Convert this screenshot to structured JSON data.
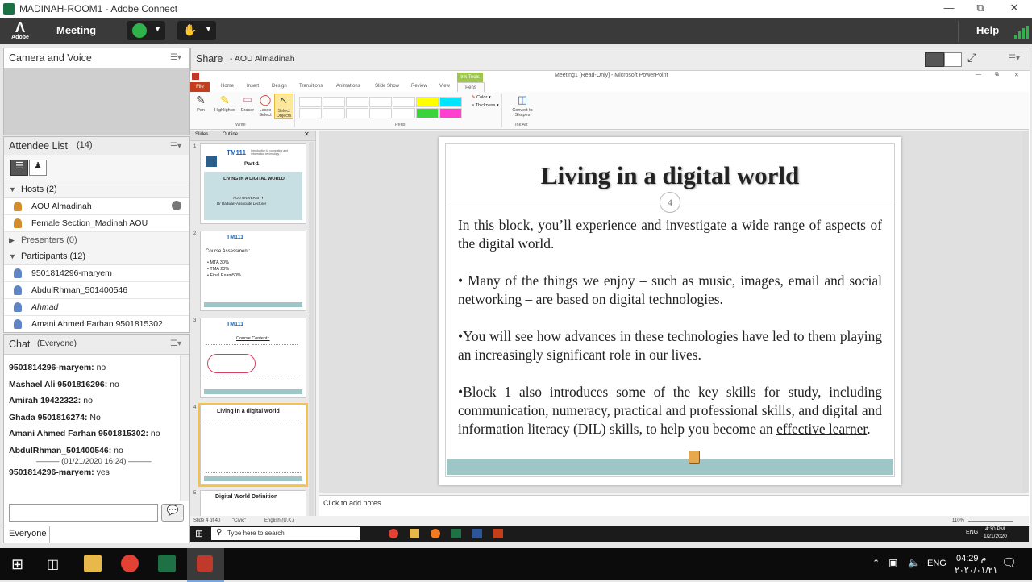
{
  "window": {
    "title": "MADINAH-ROOM1 - Adobe Connect"
  },
  "menubar": {
    "logo": "Adobe",
    "meeting_label": "Meeting",
    "help_label": "Help"
  },
  "camera_pane": {
    "title": "Camera and Voice"
  },
  "attendee_pane": {
    "title": "Attendee List",
    "count": "(14)",
    "groups": [
      {
        "label": "Hosts (2)",
        "members": [
          "AOU  Almadinah",
          "Female Section_Madinah AOU"
        ]
      },
      {
        "label": "Presenters (0)",
        "members": []
      },
      {
        "label": "Participants (12)",
        "members": [
          "9501814296-maryem",
          "AbdulRhman_501400546",
          "Ahmad",
          "Amani Ahmed Farhan 9501815302"
        ]
      }
    ]
  },
  "chat_pane": {
    "title": "Chat",
    "scope": "(Everyone)",
    "messages": [
      {
        "sender": "9501814296-maryem:",
        "text": "no"
      },
      {
        "sender": "Mashael Ali 9501816296:",
        "text": "no"
      },
      {
        "sender": "Amirah 19422322:",
        "text": "no"
      },
      {
        "sender": "Ghada 9501816274:",
        "text": "No"
      },
      {
        "sender": "Amani Ahmed Farhan 9501815302:",
        "text": "no"
      },
      {
        "sender": "AbdulRhman_501400546:",
        "text": "no"
      }
    ],
    "separator": "——— (01/21/2020 16:24) ———",
    "last_message": {
      "sender": "9501814296-maryem:",
      "text": "yes"
    },
    "recipient": "Everyone"
  },
  "share_pane": {
    "title": "Share",
    "presenter": "- AOU  Almadinah"
  },
  "powerpoint": {
    "title": "Meeting1 [Read-Only] - Microsoft PowerPoint",
    "tabs": [
      "File",
      "Home",
      "Insert",
      "Design",
      "Transitions",
      "Animations",
      "Slide Show",
      "Review",
      "View",
      "Pens"
    ],
    "context_tab": "Ink Tools",
    "tools": [
      "Pen",
      "Highlighter",
      "Eraser",
      "Lasso Select",
      "Select Objects"
    ],
    "group_write": "Write",
    "group_pens": "Pens",
    "group_inkart": "Ink Art",
    "color_label": "Color",
    "thickness_label": "Thickness",
    "convert_label": "Convert to Shapes",
    "panel_tabs": [
      "Slides",
      "Outline"
    ],
    "thumb1": {
      "code": "TM111",
      "sub": "Introduction to computing and information technology 1",
      "part": "Part-1",
      "title": "LIVING IN A DIGITAL WORLD",
      "uni": "AOU UNIVERSITY",
      "lect": "Dr Radwan-Associate Lecturer"
    },
    "thumb2": {
      "code": "TM111",
      "heading": "Course Assessment:",
      "items": [
        "MTA 30%",
        "TMA 20%",
        "Final Exam50%"
      ]
    },
    "thumb3": {
      "code": "TM111",
      "heading": "Course Content :"
    },
    "thumb4": {
      "title": "Living in a digital world"
    },
    "thumb5": {
      "title": "Digital World Definition"
    },
    "slide": {
      "title": "Living in a digital world",
      "number": "4",
      "p1": "In this block, you’ll experience and investigate a wide range of aspects of the digital world.",
      "p2": "• Many of the things we enjoy – such as music, images, email and social networking – are based on digital technologies.",
      "p3": "•You will see how advances in these technologies have led to them playing an increasingly significant role in our lives.",
      "p4": "•Block 1 also introduces some of the key skills for study, including communication, numeracy, practical and professional skills, and digital and information literacy (DIL) skills, to help you become an",
      "p4_link": "effective learner",
      "p4_end": "."
    },
    "notes_placeholder": "Click to add notes",
    "status_slide": "Slide 4 of 40",
    "status_theme": "\"Civic\"",
    "status_lang": "English (U.K.)",
    "status_zoom": "110%"
  },
  "inner_taskbar": {
    "search": "Type here to search",
    "time": "4:30 PM",
    "date": "1/21/2020",
    "lang": "ENG"
  },
  "taskbar": {
    "lang": "ENG",
    "time": "04:29 م",
    "date": "٢٠٢٠/٠١/٢١"
  }
}
